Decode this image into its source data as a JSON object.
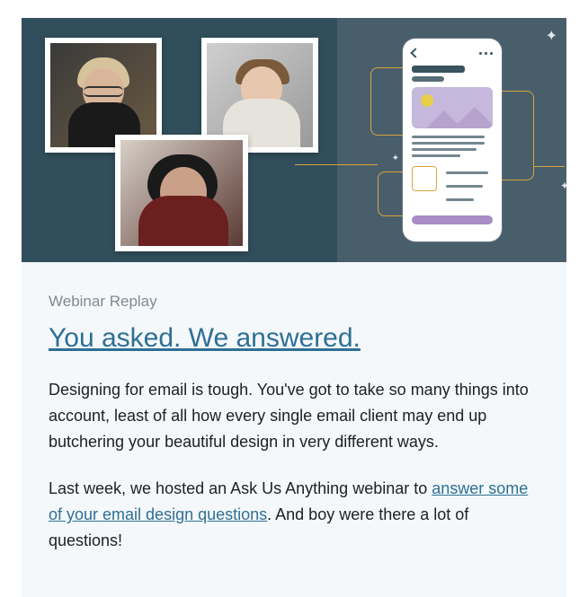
{
  "kicker": "Webinar Replay",
  "headline": "You asked. We answered.",
  "paragraph1": "Designing for email is tough. You've got to take so many things into account, least of all how every single email client may end up butchering your beautiful design in very different ways.",
  "paragraph2_pre": "Last week, we hosted an Ask Us Anything webinar to ",
  "paragraph2_link": "answer some of your email design questions",
  "paragraph2_post": ". And boy were there a lot of questions!"
}
